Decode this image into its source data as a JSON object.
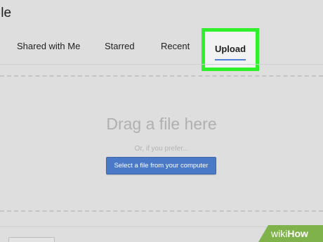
{
  "dialog": {
    "title_fragment": "ile"
  },
  "tabs": [
    {
      "label": "Shared with Me"
    },
    {
      "label": "Starred"
    },
    {
      "label": "Recent"
    },
    {
      "label": "Upload",
      "active": true
    }
  ],
  "colors": {
    "highlight": "#2ff02b",
    "accent": "#4d7fd6",
    "button": "#4a79c8"
  },
  "drop_zone": {
    "heading": "Drag a file here",
    "hint": "Or, if you prefer...",
    "button_label": "Select a file from your computer"
  },
  "watermark": {
    "wiki": "wiki",
    "how": "How"
  }
}
